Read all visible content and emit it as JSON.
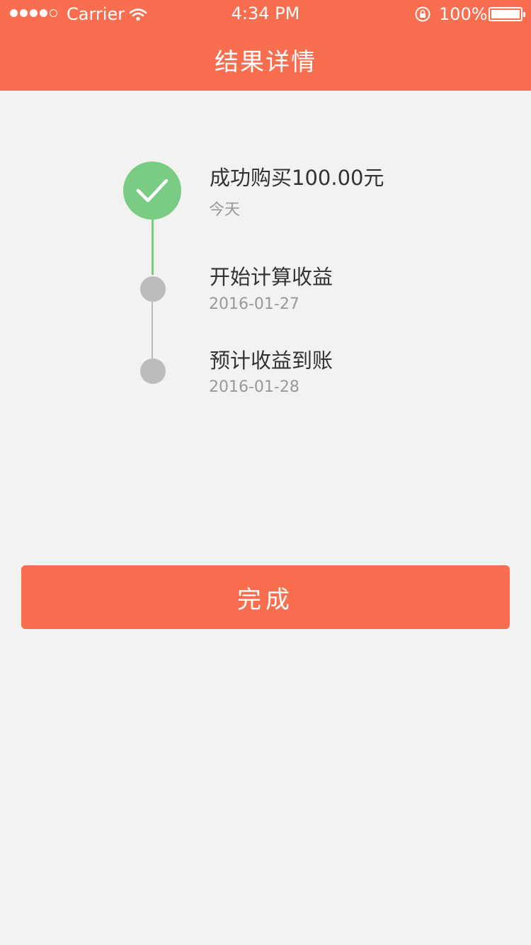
{
  "status_bar": {
    "carrier": "Carrier",
    "time": "4:34 PM",
    "battery": "100%"
  },
  "header": {
    "title": "结果详情"
  },
  "timeline": {
    "steps": [
      {
        "title": "成功购买100.00元",
        "subtitle": "今天",
        "status": "done"
      },
      {
        "title": "开始计算收益",
        "subtitle": "2016-01-27",
        "status": "pending"
      },
      {
        "title": "预计收益到账",
        "subtitle": "2016-01-28",
        "status": "pending"
      }
    ]
  },
  "actions": {
    "done_label": "完成"
  },
  "colors": {
    "accent": "#f86e4f",
    "success": "#7acb84",
    "pending": "#bcbcbc",
    "background": "#f2f2f0"
  }
}
